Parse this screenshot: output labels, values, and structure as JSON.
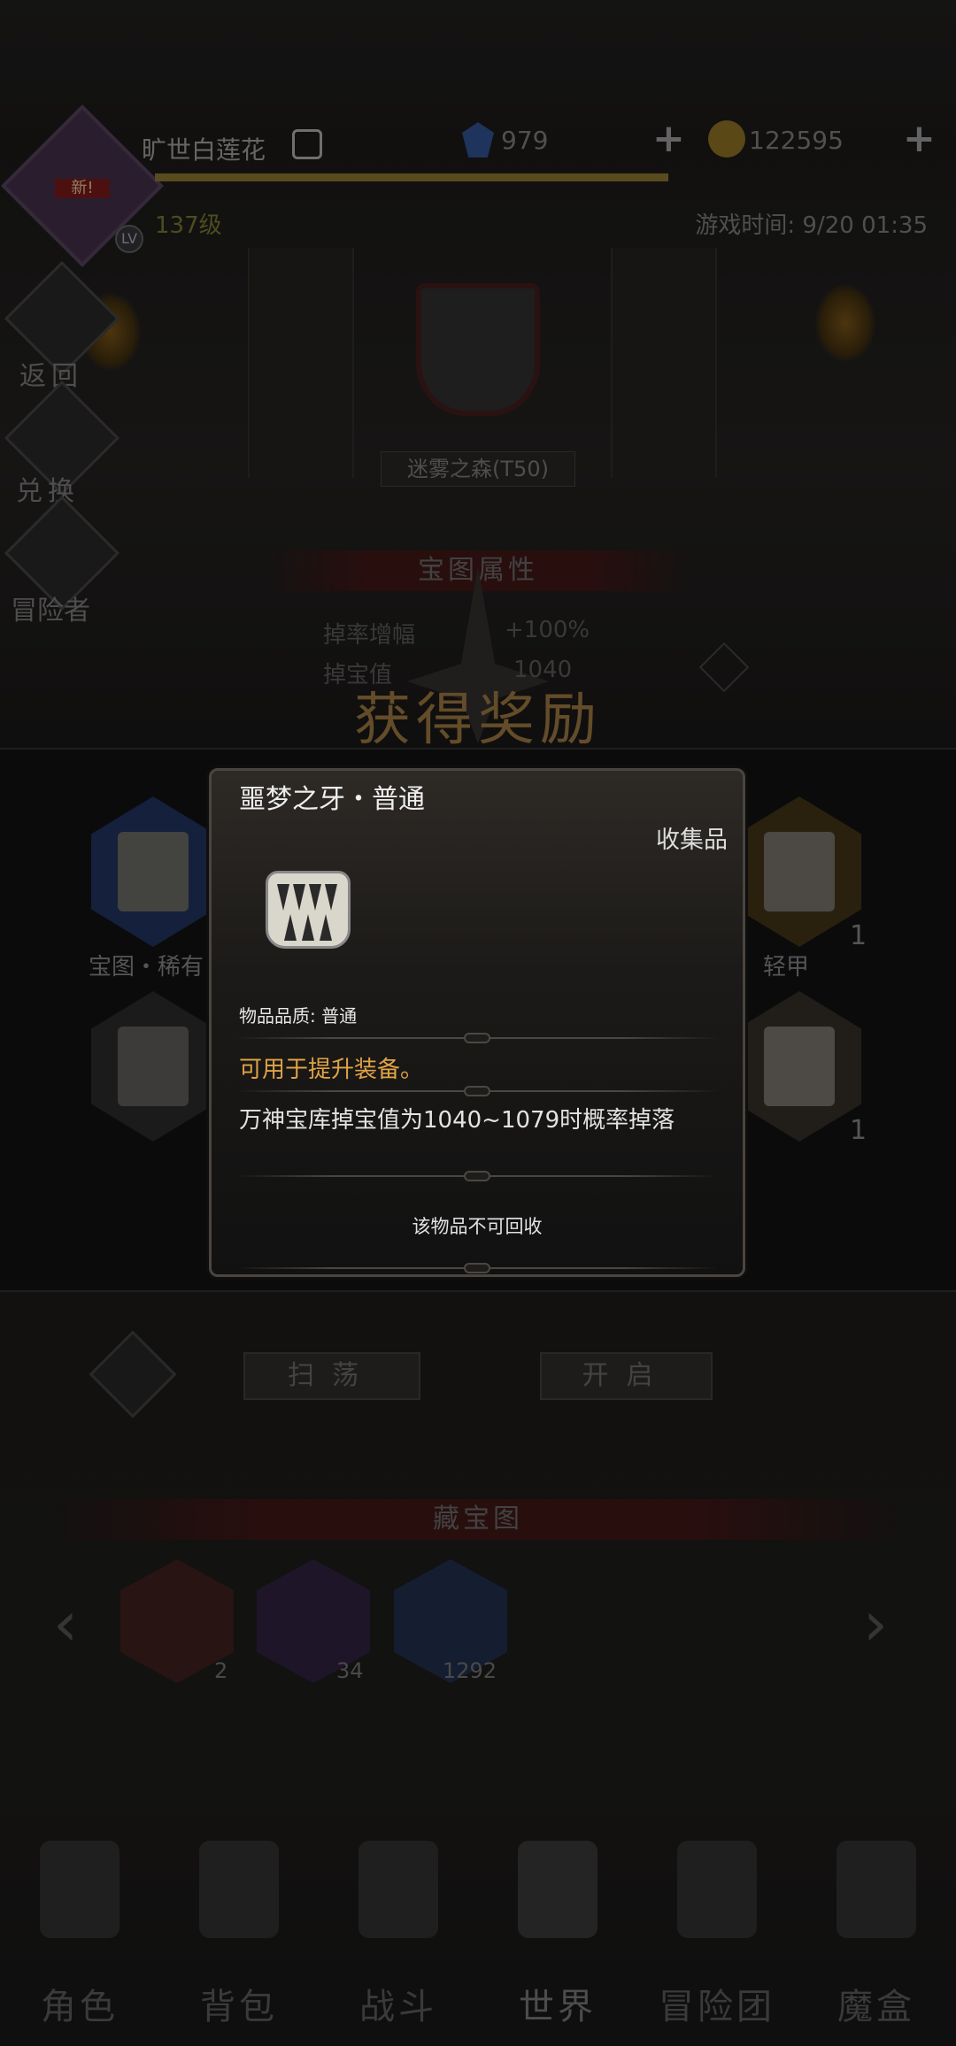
{
  "hud": {
    "player_name": "旷世白莲花",
    "level": "137级",
    "avatar_badge": "新!",
    "level_chip": "LV",
    "gems": "979",
    "gold": "122595",
    "game_time": "游戏时间: 9/20 01:35"
  },
  "side": {
    "back": "返回",
    "exchange": "兑换",
    "adventurer": "冒险者"
  },
  "map": {
    "name": "迷雾之森(T50)",
    "section_title": "宝图属性",
    "attrs": [
      {
        "label": "掉率增幅",
        "value": "+100%"
      },
      {
        "label": "掉宝值",
        "value": "1040"
      }
    ]
  },
  "reward": {
    "title": "获得奖励",
    "items": [
      {
        "label": "宝图・稀有",
        "count": ""
      },
      {
        "label": "轻甲",
        "count": "1"
      },
      {
        "label": "",
        "count": ""
      },
      {
        "label": "",
        "count": "1"
      }
    ]
  },
  "buttons": {
    "sweep": "扫荡",
    "open": "开启"
  },
  "treasure": {
    "section_title": "藏宝图",
    "counts": [
      "2",
      "34",
      "1292"
    ]
  },
  "popup": {
    "title": "噩梦之牙・普通",
    "category": "收集品",
    "quality": "物品品质: 普通",
    "usage": "可用于提升装备。",
    "description": "万神宝库掉宝值为1040~1079时概率掉落",
    "recycle": "该物品不可回收"
  },
  "nav": [
    "角色",
    "背包",
    "战斗",
    "世界",
    "冒险团",
    "魔盒"
  ],
  "colors": {
    "usage_text": "#e0a345",
    "reward_title": "#8a6a3a",
    "gem": "#2a4880",
    "gold": "#7d6520"
  }
}
